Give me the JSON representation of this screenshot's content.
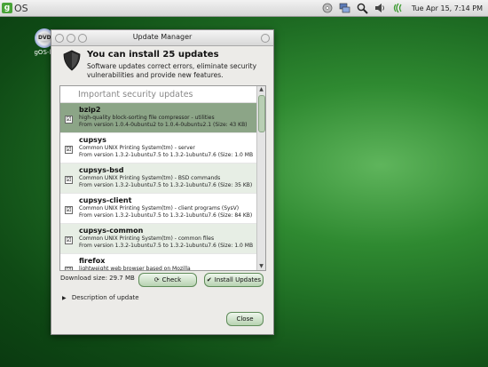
{
  "topbar": {
    "logo_letter": "g",
    "logo_text": "OS",
    "clock": "Tue Apr 15,  7:14 PM",
    "icons": [
      "cd-icon",
      "network-icon",
      "search-icon",
      "volume-icon",
      "wifi-icon"
    ]
  },
  "desktop": {
    "icon_label": "gOS-lv",
    "icon_badge": "DVD"
  },
  "window": {
    "title": "Update Manager",
    "header_title": "You can install 25 updates",
    "header_desc": "Software updates correct errors, eliminate security vulnerabilities and provide new features.",
    "section": "Important security updates",
    "updates": [
      {
        "name": "bzip2",
        "desc": "high-quality block-sorting file compressor - utilities",
        "version": "From version 1.0.4-0ubuntu2 to 1.0.4-0ubuntu2.1 (Size: 43 KB)",
        "checked": "☑",
        "state": "sel"
      },
      {
        "name": "cupsys",
        "desc": "Common UNIX Printing System(tm) - server",
        "version": "From version 1.3.2-1ubuntu7.5 to 1.3.2-1ubuntu7.6 (Size: 1.0 MB",
        "checked": "☑",
        "state": ""
      },
      {
        "name": "cupsys-bsd",
        "desc": "Common UNIX Printing System(tm) - BSD commands",
        "version": "From version 1.3.2-1ubuntu7.5 to 1.3.2-1ubuntu7.6 (Size: 35 KB)",
        "checked": "☑",
        "state": "alt"
      },
      {
        "name": "cupsys-client",
        "desc": "Common UNIX Printing System(tm) - client programs (SysV)",
        "version": "From version 1.3.2-1ubuntu7.5 to 1.3.2-1ubuntu7.6 (Size: 84 KB)",
        "checked": "☑",
        "state": ""
      },
      {
        "name": "cupsys-common",
        "desc": "Common UNIX Printing System(tm) - common files",
        "version": "From version 1.3.2-1ubuntu7.5 to 1.3.2-1ubuntu7.6 (Size: 1.0 MB",
        "checked": "☑",
        "state": "alt"
      },
      {
        "name": "firefox",
        "desc": "lightweight web browser based on Mozilla",
        "version": "",
        "checked": "☑",
        "state": ""
      }
    ],
    "download_size": "Download size: 29.7 MB",
    "check_label": "Check",
    "install_label": "Install Updates",
    "description_toggle": "Description of update",
    "close_label": "Close"
  },
  "colors": {
    "accent": "#49a338",
    "selected_row": "#8ca587",
    "alt_row": "#e7eee5"
  }
}
